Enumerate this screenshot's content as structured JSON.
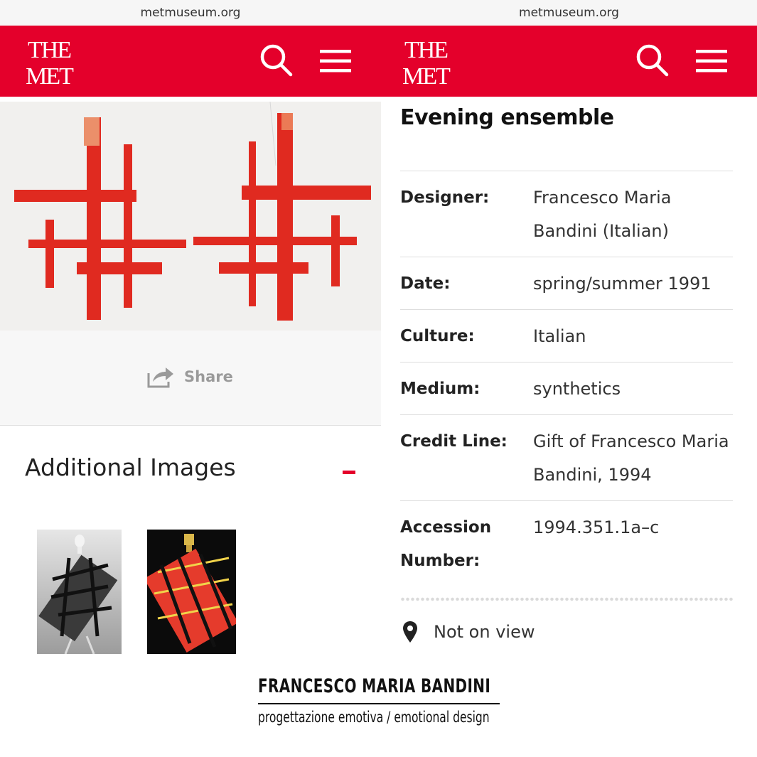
{
  "left": {
    "url": "metmuseum.org",
    "logo_alt": "THE MET",
    "share_label": "Share",
    "additional_images_title": "Additional Images"
  },
  "right": {
    "url": "metmuseum.org",
    "logo_alt": "THE MET",
    "object_title": "Evening ensemble",
    "details": [
      {
        "label": "Designer:",
        "value": "Francesco Maria Bandini (Italian)"
      },
      {
        "label": "Date:",
        "value": "spring/summer 1991"
      },
      {
        "label": "Culture:",
        "value": "Italian"
      },
      {
        "label": "Medium:",
        "value": "synthetics"
      },
      {
        "label": "Credit Line:",
        "value": "Gift of Francesco Maria Bandini, 1994"
      },
      {
        "label": "Accession Number:",
        "value": "1994.351.1a–c"
      }
    ],
    "location": "Not on view"
  },
  "caption": {
    "title": "FRANCESCO MARIA BANDINI",
    "subtitle": "progettazione emotiva / emotional design"
  },
  "colors": {
    "brand_red": "#e4002b",
    "garment_red": "#e02a20",
    "share_gray": "#9a9a9a"
  },
  "icons": {
    "search": "search-icon",
    "menu": "hamburger-menu-icon",
    "share": "share-icon",
    "location": "map-pin-icon"
  }
}
